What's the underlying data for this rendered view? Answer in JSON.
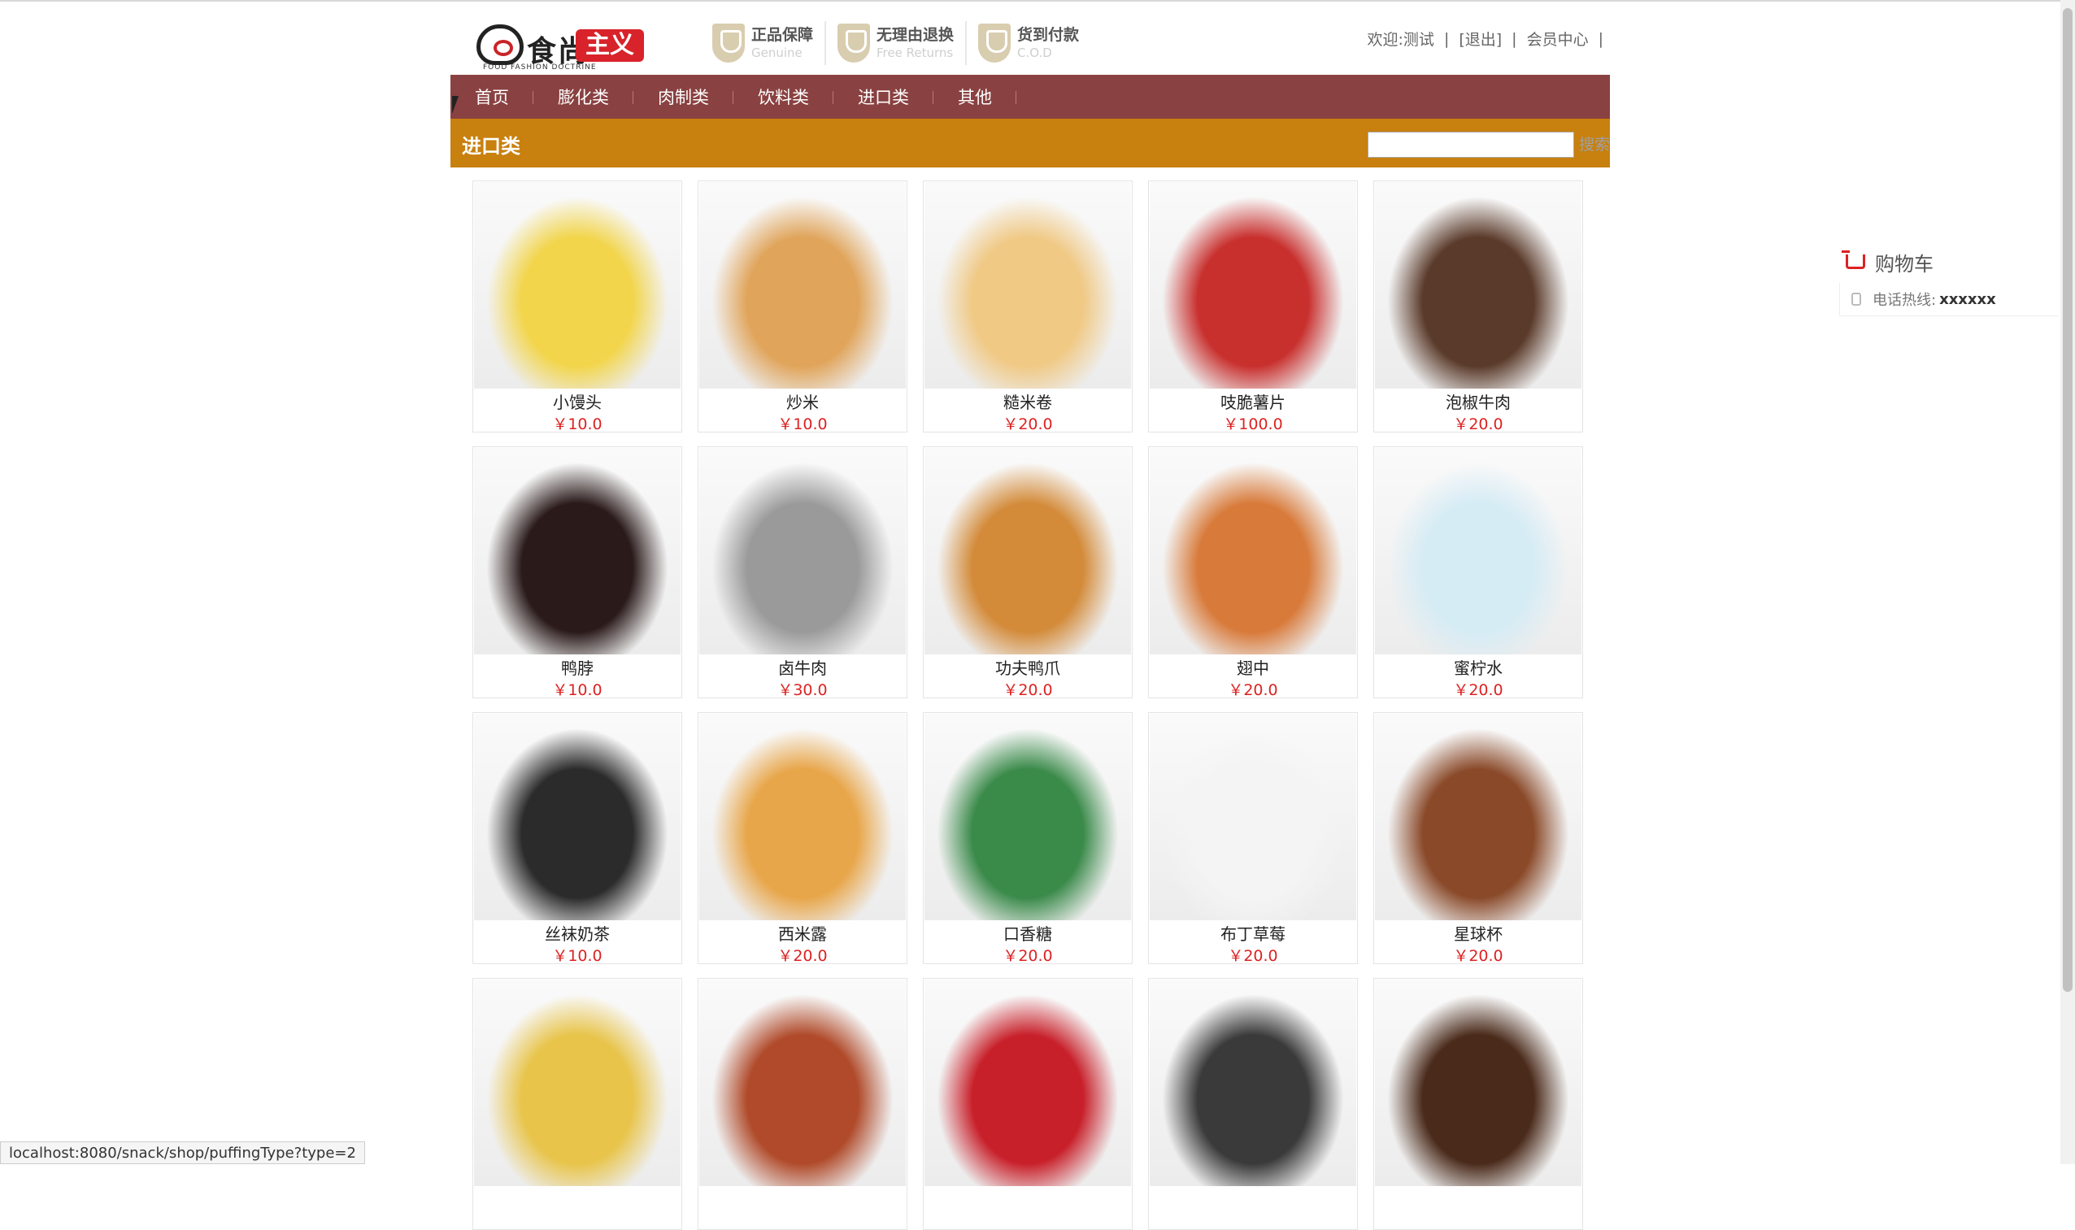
{
  "header": {
    "logo_cn": "食尚",
    "logo_red": "主义",
    "logo_sub": "FOOD FASHION DOCTRINE",
    "guarantees": [
      {
        "title": "正品保障",
        "sub": "Genuine"
      },
      {
        "title": "无理由退换",
        "sub": "Free Returns"
      },
      {
        "title": "货到付款",
        "sub": "C.O.D"
      }
    ],
    "welcome": "欢迎:测试",
    "logout": "[退出]",
    "member_center": "会员中心"
  },
  "nav": [
    "首页",
    "膨化类",
    "肉制类",
    "饮料类",
    "进口类",
    "其他"
  ],
  "category": {
    "title": "进口类",
    "search_label": "搜索"
  },
  "products": [
    {
      "name": "小馒头",
      "price": "￥10.0",
      "color": "#f2d54b"
    },
    {
      "name": "炒米",
      "price": "￥10.0",
      "color": "#e0a45a"
    },
    {
      "name": "糙米卷",
      "price": "￥20.0",
      "color": "#f0c985"
    },
    {
      "name": "吱脆薯片",
      "price": "￥100.0",
      "color": "#c8302e"
    },
    {
      "name": "泡椒牛肉",
      "price": "￥20.0",
      "color": "#5a3a2a"
    },
    {
      "name": "鸭脖",
      "price": "￥10.0",
      "color": "#2a1a1a"
    },
    {
      "name": "卤牛肉",
      "price": "￥30.0",
      "color": "#9a9a9a"
    },
    {
      "name": "功夫鸭爪",
      "price": "￥20.0",
      "color": "#d38b3a"
    },
    {
      "name": "翅中",
      "price": "￥20.0",
      "color": "#d87a3a"
    },
    {
      "name": "蜜柠水",
      "price": "￥20.0",
      "color": "#d6ecf5"
    },
    {
      "name": "丝袜奶茶",
      "price": "￥10.0",
      "color": "#2b2b2b"
    },
    {
      "name": "西米露",
      "price": "￥20.0",
      "color": "#e8a64a"
    },
    {
      "name": "口香糖",
      "price": "￥20.0",
      "color": "#3a8a4a"
    },
    {
      "name": "布丁草莓",
      "price": "￥20.0",
      "color": "#f4f4f4"
    },
    {
      "name": "星球杯",
      "price": "￥20.0",
      "color": "#8a4a2a"
    },
    {
      "name": "",
      "price": "",
      "color": "#e8c44a"
    },
    {
      "name": "",
      "price": "",
      "color": "#b04a2a"
    },
    {
      "name": "",
      "price": "",
      "color": "#c8202a"
    },
    {
      "name": "",
      "price": "",
      "color": "#3a3a3a"
    },
    {
      "name": "",
      "price": "",
      "color": "#4a2a1a"
    }
  ],
  "sidebar": {
    "cart_label": "购物车",
    "hotline_label": "电话热线:",
    "hotline_number": "xxxxxx"
  },
  "status_url": "localhost:8080/snack/shop/puffingType?type=2"
}
